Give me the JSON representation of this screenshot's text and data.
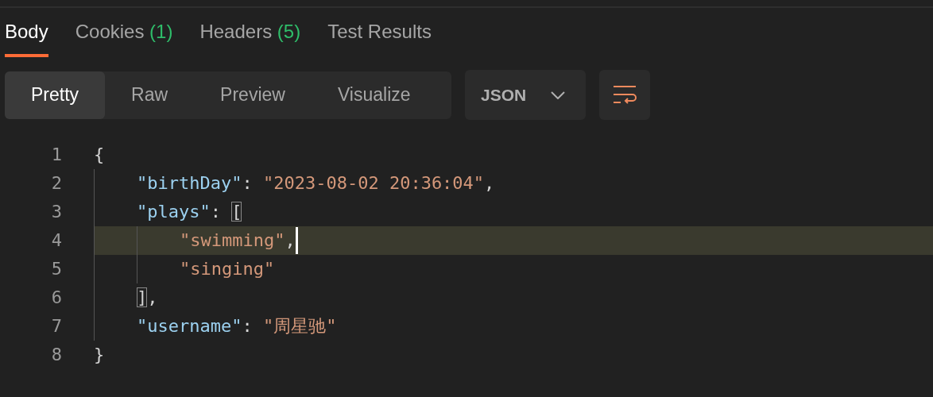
{
  "tabs": [
    {
      "label": "Body",
      "selected": true
    },
    {
      "label": "Cookies",
      "count": "(1)",
      "selected": false
    },
    {
      "label": "Headers",
      "count": "(5)",
      "selected": false
    },
    {
      "label": "Test Results",
      "selected": false
    }
  ],
  "view_modes": [
    {
      "label": "Pretty",
      "selected": true
    },
    {
      "label": "Raw",
      "selected": false
    },
    {
      "label": "Preview",
      "selected": false
    },
    {
      "label": "Visualize",
      "selected": false
    }
  ],
  "format_dropdown": {
    "value": "JSON"
  },
  "code_lines": [
    {
      "number": "1",
      "selected": false,
      "tokens": [
        {
          "kind": "punct",
          "text": "{"
        }
      ]
    },
    {
      "number": "2",
      "selected": false,
      "tokens": [
        {
          "kind": "indent"
        },
        {
          "kind": "key",
          "text": "\"birthDay\""
        },
        {
          "kind": "punct",
          "text": ": "
        },
        {
          "kind": "string",
          "text": "\"2023-08-02 20:36:04\""
        },
        {
          "kind": "punct",
          "text": ","
        }
      ]
    },
    {
      "number": "3",
      "selected": false,
      "tokens": [
        {
          "kind": "indent"
        },
        {
          "kind": "key",
          "text": "\"plays\""
        },
        {
          "kind": "punct",
          "text": ": "
        },
        {
          "kind": "match",
          "text": "["
        }
      ]
    },
    {
      "number": "4",
      "selected": true,
      "tokens": [
        {
          "kind": "indent"
        },
        {
          "kind": "indent"
        },
        {
          "kind": "string",
          "text": "\"swimming\""
        },
        {
          "kind": "punct",
          "text": ","
        }
      ]
    },
    {
      "number": "5",
      "selected": false,
      "tokens": [
        {
          "kind": "indent"
        },
        {
          "kind": "indent"
        },
        {
          "kind": "string",
          "text": "\"singing\""
        }
      ]
    },
    {
      "number": "6",
      "selected": false,
      "tokens": [
        {
          "kind": "indent"
        },
        {
          "kind": "match",
          "text": "]"
        },
        {
          "kind": "punct",
          "text": ","
        }
      ]
    },
    {
      "number": "7",
      "selected": false,
      "tokens": [
        {
          "kind": "indent"
        },
        {
          "kind": "key",
          "text": "\"username\""
        },
        {
          "kind": "punct",
          "text": ": "
        },
        {
          "kind": "string",
          "text": "\"周星驰\""
        }
      ]
    },
    {
      "number": "8",
      "selected": false,
      "tokens": [
        {
          "kind": "punct",
          "text": "}"
        }
      ]
    }
  ]
}
